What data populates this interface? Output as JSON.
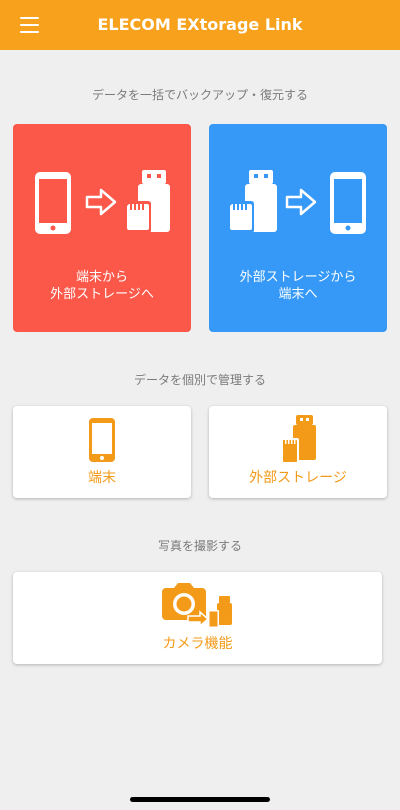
{
  "header": {
    "title": "ELECOM EXtorage Link",
    "menu_icon": "hamburger-menu-icon",
    "background": "#f7a11c"
  },
  "backup_section": {
    "label": "データを一括でバックアップ・復元する",
    "to_storage": {
      "line1": "端末から",
      "line2": "外部ストレージへ",
      "color": "#fb584a",
      "icons": [
        "smartphone-icon",
        "arrow-right-icon",
        "usb-sd-storage-icon"
      ]
    },
    "to_device": {
      "line1": "外部ストレージから",
      "line2": "端末へ",
      "color": "#3699f7",
      "icons": [
        "usb-sd-storage-icon",
        "arrow-right-icon",
        "smartphone-icon"
      ]
    }
  },
  "manage_section": {
    "label": "データを個別で管理する",
    "device_label": "端末",
    "storage_label": "外部ストレージ"
  },
  "camera_section": {
    "label": "写真を撮影する",
    "camera_label": "カメラ機能"
  },
  "colors": {
    "accent_orange": "#f49a19",
    "background": "#efefef",
    "section_text": "#7a7a7a"
  }
}
